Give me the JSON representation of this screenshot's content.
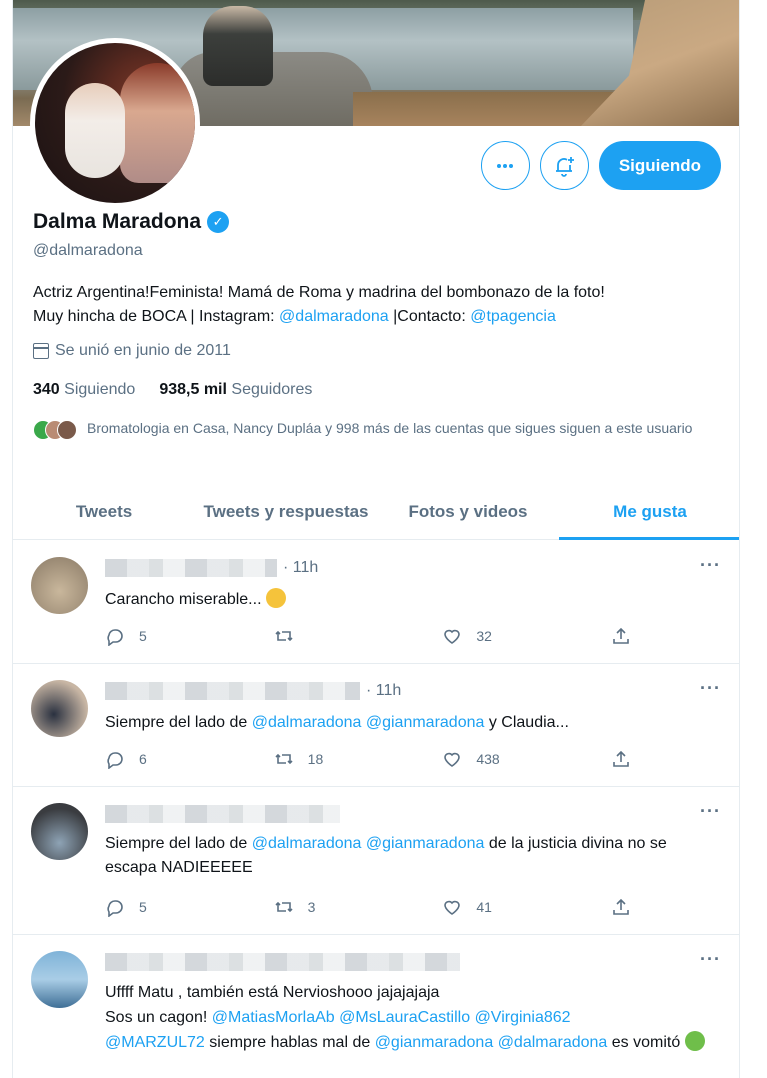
{
  "profile": {
    "name": "Dalma Maradona",
    "handle": "@dalmaradona",
    "bio_text1": "Actriz Argentina!Feminista! Mamá de Roma y madrina del bombonazo de la foto!",
    "bio_text2": "Muy hincha de BOCA | Instagram: ",
    "bio_link1": "@dalmaradona",
    "bio_text3": " |Contacto: ",
    "bio_link2": "@tpagencia",
    "joined": "Se unió en junio de 2011",
    "following_count": "340",
    "following_label": "Siguiendo",
    "followers_count": "938,5 mil",
    "followers_label": "Seguidores",
    "known_followers": "Bromatologia en Casa, Nancy Dupláa y 998 más de las cuentas que sigues siguen a este usuario"
  },
  "actions": {
    "more_icon": "more-horizontal-icon",
    "notify_icon": "bell-plus-icon",
    "follow_label": "Siguiendo"
  },
  "tabs": [
    {
      "label": "Tweets"
    },
    {
      "label": "Tweets y respuestas"
    },
    {
      "label": "Fotos y videos"
    },
    {
      "label": "Me gusta"
    }
  ],
  "tweets": [
    {
      "time": "· 11h",
      "text": "Carancho miserable...",
      "emoji": "grimacing-face",
      "replies": "5",
      "retweets": "",
      "likes": "32"
    },
    {
      "time": "· 11h",
      "text_pre": "Siempre del lado de ",
      "mention1": "@dalmaradona",
      "mention2": "@gianmaradona",
      "text_post": " y Claudia...",
      "replies": "6",
      "retweets": "18",
      "likes": "438"
    },
    {
      "time": "",
      "text_pre": "Siempre del lado de  ",
      "mention1": "@dalmaradona",
      "mention2": "@gianmaradona",
      "text_post": " de la justicia divina no se escapa NADIEEEEE",
      "replies": "5",
      "retweets": "3",
      "likes": "41"
    },
    {
      "time": "",
      "line1": "Uffff Matu , también está Nervioshooo jajajajaja",
      "line2_pre": "Sos un cagon! ",
      "m1": "@MatiasMorlaAb",
      "m2": "@MsLauraCastillo",
      "m3": "@Virginia862",
      "m4": "@MARZUL72",
      "mid": "  siempre hablas mal de ",
      "m5": "@gianmaradona",
      "m6": "@dalmaradona",
      "tail": "  es vomitó",
      "emoji": "nauseated-face"
    }
  ],
  "colors": {
    "accent": "#1da1f2",
    "secondary_text": "#5b7083",
    "border": "#e6ecf0"
  }
}
